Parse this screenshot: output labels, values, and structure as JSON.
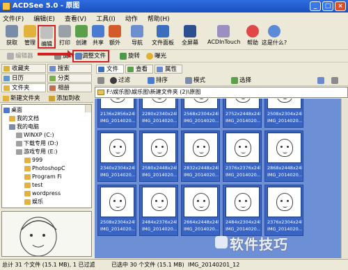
{
  "window": {
    "title": "ACDSee 5.0 - 原图"
  },
  "window_buttons": [
    "_",
    "□",
    "×"
  ],
  "menu": [
    "文件(F)",
    "编辑(E)",
    "查看(V)",
    "工具(I)",
    "动作",
    "帮助(H)"
  ],
  "toolbar": {
    "acquire": "获取",
    "manage": "管理",
    "edit": "编辑",
    "print": "打印",
    "create": "创建",
    "share": "共享",
    "external": "额外",
    "navigate": "导航",
    "file_panel": "文件面板",
    "fullscreen": "全屏幕",
    "acdintouch": "ACDInTouch",
    "help": "帮助",
    "whats_this": "这是什么?"
  },
  "toolbar2": {
    "editor": "编辑器",
    "rotate_label": "旋转",
    "resize": "调整文件",
    "rotate": "旋转",
    "exposure": "曝光"
  },
  "left_panel": {
    "tabs_row1": [
      "收藏夹",
      "搜索"
    ],
    "tabs_row2": [
      "日历",
      "分类"
    ],
    "tabs_row3": [
      "文件夹",
      "相册"
    ],
    "sub_new_folder": "新建文件夹",
    "sub_add_favorite": "添加到收",
    "tree": [
      {
        "label": "桌面",
        "indent": 0
      },
      {
        "label": "我的文档",
        "indent": 1
      },
      {
        "label": "我的电脑",
        "indent": 1
      },
      {
        "label": "WINXP (C:)",
        "indent": 2
      },
      {
        "label": "下载专用 (D:)",
        "indent": 2
      },
      {
        "label": "游戏专用 (E:)",
        "indent": 2
      },
      {
        "label": "999",
        "indent": 3
      },
      {
        "label": "PhotoshopC",
        "indent": 3
      },
      {
        "label": "Program Fi",
        "indent": 3
      },
      {
        "label": "test",
        "indent": 3
      },
      {
        "label": "wordpress",
        "indent": 3
      },
      {
        "label": "娱乐",
        "indent": 3
      }
    ]
  },
  "main": {
    "tabs": [
      "文件",
      "查看",
      "属性"
    ],
    "filter": {
      "filter": "过滤",
      "sort": "排序",
      "view": "模式",
      "select": "选择"
    },
    "path": "F:\\娱乐图\\娱乐图\\新建文件夹 (2)\\原图",
    "thumbnails": [
      {
        "l1": "2136x2856x24b",
        "l2": "IMG_2014020..."
      },
      {
        "l1": "2280x2340x24b",
        "l2": "IMG_2014020..."
      },
      {
        "l1": "2568x2304x24b",
        "l2": "IMG_2014020..."
      },
      {
        "l1": "2752x2448x24b",
        "l2": "IMG_2014020..."
      },
      {
        "l1": "2508x2304x24b",
        "l2": "IMG_2014020..."
      },
      {
        "l1": "2340x2304x24b",
        "l2": "IMG_2014020..."
      },
      {
        "l1": "2580x2448x24b",
        "l2": "IMG_2014020..."
      },
      {
        "l1": "2832x2448x24b",
        "l2": "IMG_2014020..."
      },
      {
        "l1": "2376x2376x24b",
        "l2": "IMG_2014020..."
      },
      {
        "l1": "2868x2448x24b",
        "l2": "IMG_2014020..."
      },
      {
        "l1": "2508x2304x24b",
        "l2": "IMG_2014020..."
      },
      {
        "l1": "2484x2376x24b",
        "l2": "IMG_2014020..."
      },
      {
        "l1": "2664x2448x24b",
        "l2": "IMG_2014020..."
      },
      {
        "l1": "2484x2304x24b",
        "l2": "IMG_2014020..."
      },
      {
        "l1": "2376x2304x24b",
        "l2": "IMG_2014020..."
      }
    ]
  },
  "status": {
    "total": "总计 31 个文件 (15.1 MB), 1 已过滤",
    "selected": "已选中 30 个文件 (15.1 MB)",
    "file": "IMG_20140201_12"
  },
  "watermark": "软件技巧"
}
